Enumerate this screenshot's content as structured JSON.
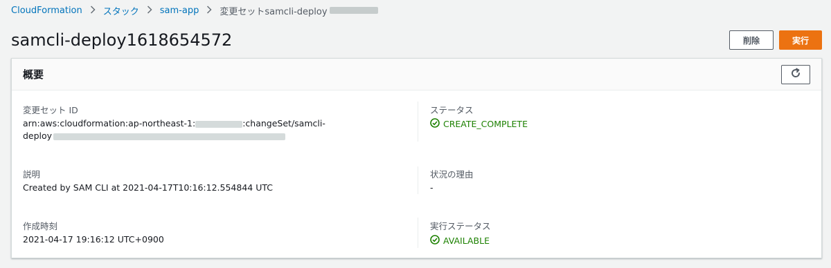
{
  "breadcrumb": {
    "items": [
      "CloudFormation",
      "スタック",
      "sam-app"
    ],
    "current": "変更セットsamcli-deploy"
  },
  "header": {
    "title": "samcli-deploy1618654572",
    "delete_label": "削除",
    "execute_label": "実行"
  },
  "overview": {
    "title": "概要",
    "changeset_id": {
      "label": "変更セット ID",
      "line1_prefix": "arn:aws:cloudformation:ap-northeast-1:",
      "line1_suffix": ":changeSet/samcli-",
      "line2_prefix": "deploy"
    },
    "status": {
      "label": "ステータス",
      "value": "CREATE_COMPLETE"
    },
    "description": {
      "label": "説明",
      "value": "Created by SAM CLI at 2021-04-17T10:16:12.554844 UTC"
    },
    "status_reason": {
      "label": "状況の理由",
      "value": "-"
    },
    "created_time": {
      "label": "作成時刻",
      "value": "2021-04-17 19:16:12 UTC+0900"
    },
    "execution_status": {
      "label": "実行ステータス",
      "value": "AVAILABLE"
    }
  },
  "colors": {
    "link": "#0073bb",
    "accent": "#ec7211",
    "success": "#1d8102",
    "background": "#f2f3f3"
  },
  "icons": {
    "breadcrumb_separator": "chevron-right-icon",
    "refresh": "refresh-icon",
    "status": "check-circle-icon"
  }
}
